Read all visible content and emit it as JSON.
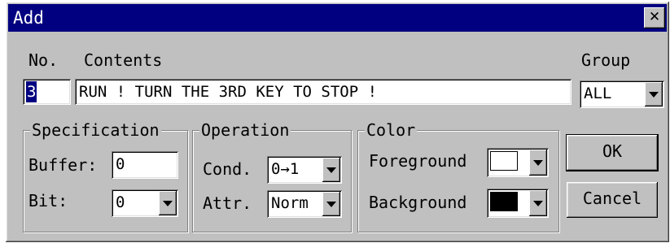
{
  "window": {
    "title": "Add",
    "close_glyph": "✕"
  },
  "labels": {
    "no": "No.",
    "contents": "Contents",
    "group": "Group"
  },
  "fields": {
    "no_value": "3",
    "contents_value": "RUN ! TURN THE 3RD KEY TO STOP !",
    "group_value": "ALL"
  },
  "specification": {
    "title": "Specification",
    "buffer_label": "Buffer:",
    "buffer_value": "0",
    "bit_label": "Bit:",
    "bit_value": "0"
  },
  "operation": {
    "title": "Operation",
    "cond_label": "Cond.",
    "cond_value": "0→1",
    "attr_label": "Attr.",
    "attr_value": "Norm"
  },
  "color": {
    "title": "Color",
    "foreground_label": "Foreground",
    "foreground_color": "#ffffff",
    "background_label": "Background",
    "background_color": "#000000"
  },
  "buttons": {
    "ok": "OK",
    "cancel": "Cancel"
  },
  "icons": {
    "close": "close-icon",
    "dropdown": "chevron-down-icon"
  }
}
